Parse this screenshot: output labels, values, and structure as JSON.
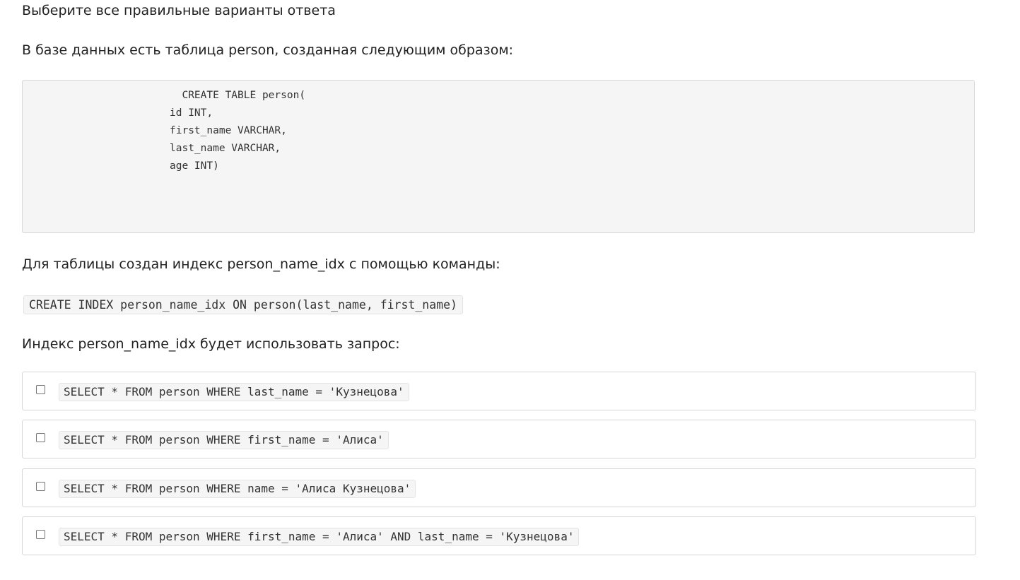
{
  "instruction": "Выберите все правильные варианты ответа",
  "intro": "В базе данных есть таблица person, созданная следующим образом:",
  "code_block": {
    "lines": [
      "  CREATE TABLE person(",
      "id INT,",
      "first_name VARCHAR,",
      "last_name VARCHAR,",
      "age INT)"
    ]
  },
  "index_intro": "Для таблицы создан индекс person_name_idx с помощью команды:",
  "index_command": "CREATE INDEX person_name_idx ON person(last_name, first_name)",
  "question": "Индекс person_name_idx будет использовать запрос:",
  "options": [
    {
      "label": "SELECT * FROM person WHERE last_name = 'Кузнецова'",
      "checked": false
    },
    {
      "label": "SELECT * FROM person WHERE first_name = 'Алиса'",
      "checked": false
    },
    {
      "label": "SELECT * FROM person WHERE name = 'Алиса Кузнецова'",
      "checked": false
    },
    {
      "label": "SELECT * FROM person WHERE first_name = 'Алиса' AND last_name = 'Кузнецова'",
      "checked": false
    }
  ]
}
